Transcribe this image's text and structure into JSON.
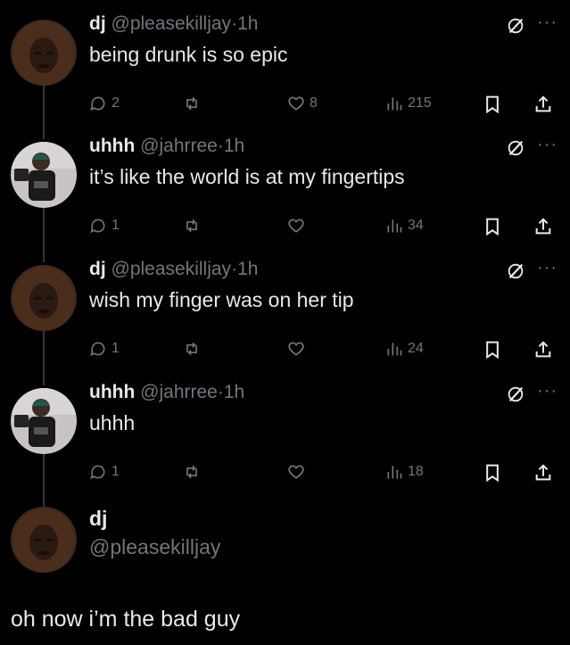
{
  "tweets": [
    {
      "name": "dj",
      "handle": "@pleasekilljay",
      "time": "1h",
      "text": "being drunk is so epic",
      "replies": "2",
      "retweets": "",
      "likes": "8",
      "views": "215",
      "avatar": "dreadlocks-avatar"
    },
    {
      "name": "uhhh",
      "handle": "@jahrree",
      "time": "1h",
      "text": "it’s like the world is at my fingertips",
      "replies": "1",
      "retweets": "",
      "likes": "",
      "views": "34",
      "avatar": "mirror-selfie-avatar"
    },
    {
      "name": "dj",
      "handle": "@pleasekilljay",
      "time": "1h",
      "text": "wish my finger was on her tip",
      "replies": "1",
      "retweets": "",
      "likes": "",
      "views": "24",
      "avatar": "dreadlocks-avatar"
    },
    {
      "name": "uhhh",
      "handle": "@jahrree",
      "time": "1h",
      "text": "uhhh",
      "replies": "1",
      "retweets": "",
      "likes": "",
      "views": "18",
      "avatar": "mirror-selfie-avatar"
    }
  ],
  "final_tweet": {
    "name": "dj",
    "handle": "@pleasekilljay",
    "text": "oh now i’m the bad guy"
  },
  "separator": "·",
  "more_glyph": "···",
  "colors": {
    "background": "#000000",
    "text": "#e7e9ea",
    "muted": "#71767b",
    "thread_line": "#333639"
  }
}
